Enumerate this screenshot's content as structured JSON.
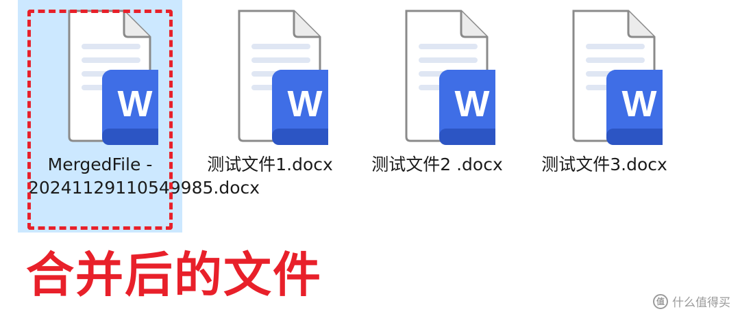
{
  "files": [
    {
      "name": "MergedFile -\n20241129110549985.docx",
      "icon": "word-document-icon",
      "badge": "W",
      "selected": true
    },
    {
      "name": "测试文件1.docx",
      "icon": "word-document-icon",
      "badge": "W",
      "selected": false
    },
    {
      "name": "测试文件2 .docx",
      "icon": "word-document-icon",
      "badge": "W",
      "selected": false
    },
    {
      "name": "测试文件3.docx",
      "icon": "word-document-icon",
      "badge": "W",
      "selected": false
    }
  ],
  "caption": "合并后的文件",
  "watermark": {
    "text": "什么值得买",
    "icon_glyph": "值"
  },
  "colors": {
    "selection_bg": "#cce8ff",
    "highlight_red": "#e8202a",
    "word_blue": "#3f6ee6"
  }
}
